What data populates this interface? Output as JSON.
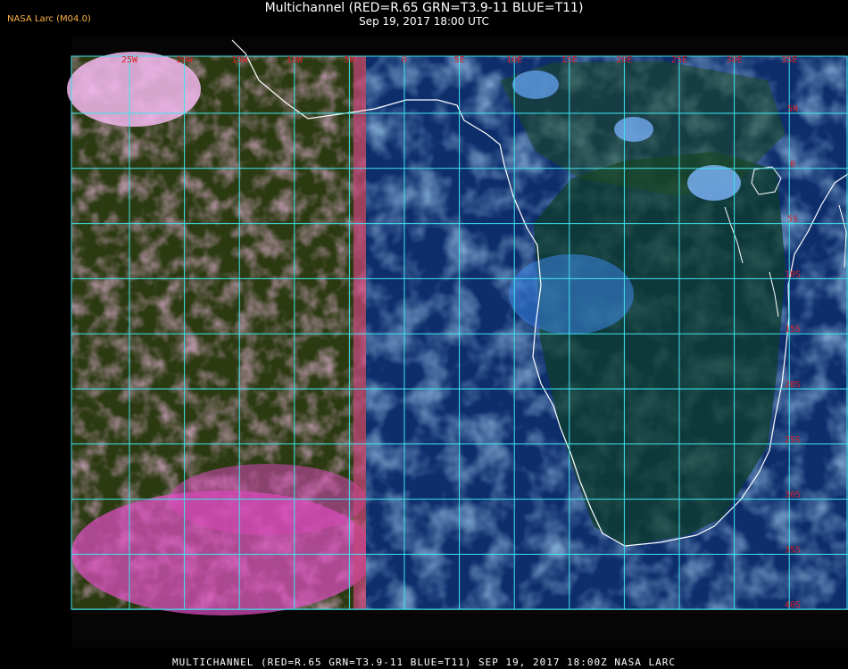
{
  "header": {
    "source": "NASA Larc (M04.0)",
    "title": "Multichannel (RED=R.65 GRN=T3.9-11 BLUE=T11)",
    "datetime": "Sep 19, 2017 18:00 UTC"
  },
  "footer": {
    "text": "MULTICHANNEL (RED=R.65 GRN=T3.9-11 BLUE=T11) SEP 19, 2017 18:00Z    NASA LARC"
  },
  "map": {
    "grid_color": "#3ee6ee",
    "coast_color": "#ffffff",
    "label_color": "#d8232a",
    "longitude_labels": [
      "25W",
      "20W",
      "15W",
      "10W",
      "5W",
      "0",
      "5E",
      "10E",
      "15E",
      "20E",
      "25E",
      "30E",
      "35E"
    ],
    "latitude_labels": [
      "5N",
      "0",
      "5S",
      "10S",
      "15S",
      "20S",
      "25S",
      "30S",
      "35S",
      "40S"
    ]
  }
}
